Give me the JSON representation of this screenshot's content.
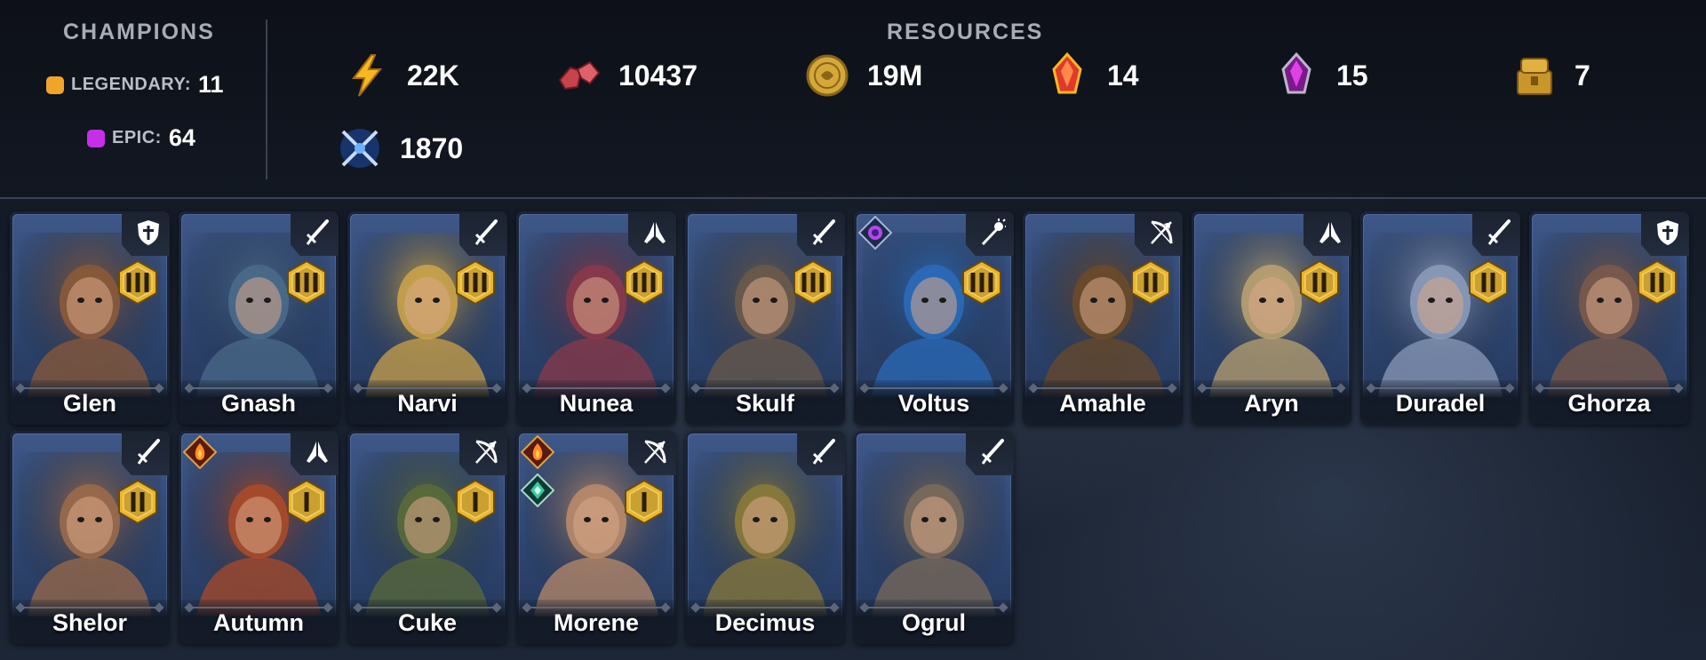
{
  "champions": {
    "title": "CHAMPIONS",
    "legendary": {
      "label": "LEGENDARY:",
      "count": "11",
      "color": "#f0a52a"
    },
    "epic": {
      "label": "EPIC:",
      "count": "64",
      "color": "#c72ee8"
    }
  },
  "resources": {
    "title": "RESOURCES",
    "items": [
      {
        "icon": "energy-icon",
        "value": "22K"
      },
      {
        "icon": "gems-icon",
        "value": "10437"
      },
      {
        "icon": "silver-coin-icon",
        "value": "19M"
      },
      {
        "icon": "sacred-shard-icon",
        "value": "14"
      },
      {
        "icon": "void-shard-icon",
        "value": "15"
      },
      {
        "icon": "gold-chest-icon",
        "value": "7"
      },
      {
        "icon": "arena-swords-icon",
        "value": "1870"
      }
    ]
  },
  "cards": [
    {
      "name": "Glen",
      "class": "shield-icon",
      "rank": "III",
      "affinities": [],
      "hue": "#8a5a3a"
    },
    {
      "name": "Gnash",
      "class": "sword-icon",
      "rank": "III",
      "affinities": [],
      "hue": "#4a6a8a"
    },
    {
      "name": "Narvi",
      "class": "sword-icon",
      "rank": "III",
      "affinities": [],
      "hue": "#c9a24a"
    },
    {
      "name": "Nunea",
      "class": "praying-hands-icon",
      "rank": "III",
      "affinities": [],
      "hue": "#8a3a4a"
    },
    {
      "name": "Skulf",
      "class": "sword-icon",
      "rank": "III",
      "affinities": [],
      "hue": "#6a5a4a"
    },
    {
      "name": "Voltus",
      "class": "magic-staff-icon",
      "rank": "III",
      "affinities": [
        "void-affinity-icon"
      ],
      "hue": "#2a6ab8"
    },
    {
      "name": "Amahle",
      "class": "bow-icon",
      "rank": "II",
      "affinities": [],
      "hue": "#6a4a2a"
    },
    {
      "name": "Aryn",
      "class": "praying-hands-icon",
      "rank": "II",
      "affinities": [],
      "hue": "#b8a070"
    },
    {
      "name": "Duradel",
      "class": "sword-icon",
      "rank": "II",
      "affinities": [],
      "hue": "#8a9ab8"
    },
    {
      "name": "Ghorza",
      "class": "shield-icon",
      "rank": "II",
      "affinities": [],
      "hue": "#7a5a4a"
    },
    {
      "name": "Shelor",
      "class": "sword-icon",
      "rank": "II",
      "affinities": [],
      "hue": "#9a6a4a"
    },
    {
      "name": "Autumn",
      "class": "praying-hands-icon",
      "rank": "I",
      "affinities": [
        "fire-affinity-icon"
      ],
      "hue": "#a84a2a"
    },
    {
      "name": "Cuke",
      "class": "bow-icon",
      "rank": "I",
      "affinities": [],
      "hue": "#5a6a3a"
    },
    {
      "name": "Morene",
      "class": "bow-icon",
      "rank": "I",
      "affinities": [
        "fire-affinity-icon",
        "spirit-affinity-icon"
      ],
      "hue": "#b88a6a"
    },
    {
      "name": "Decimus",
      "class": "sword-icon",
      "rank": "",
      "affinities": [],
      "hue": "#8a7a3a"
    },
    {
      "name": "Ogrul",
      "class": "sword-icon",
      "rank": "",
      "affinities": [],
      "hue": "#7a6a5a"
    }
  ]
}
